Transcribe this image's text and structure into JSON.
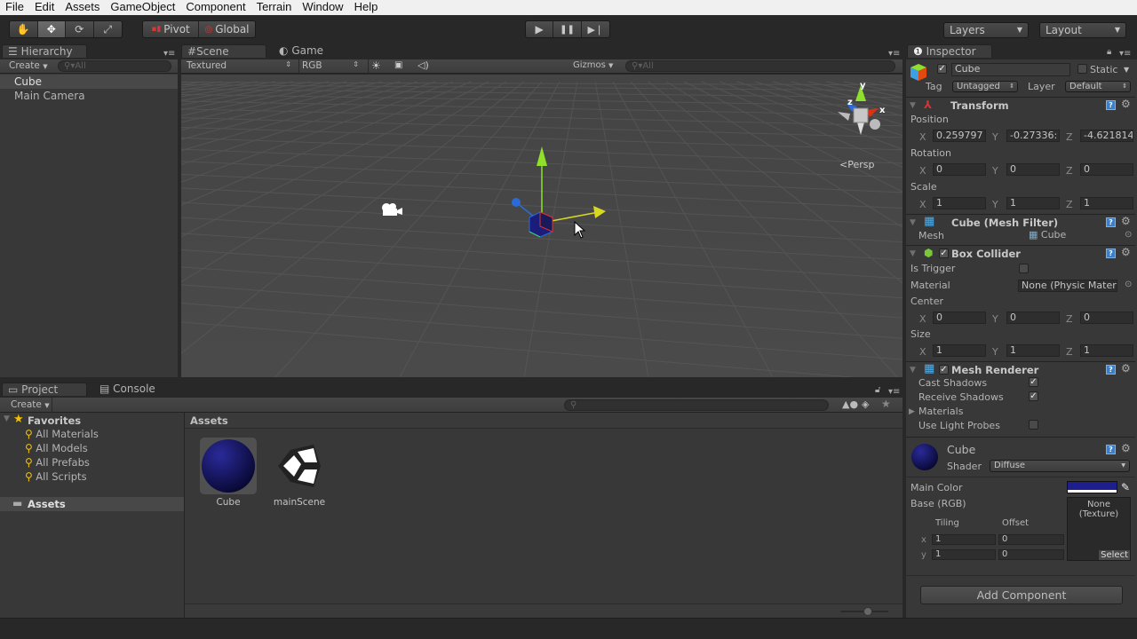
{
  "menu": [
    "File",
    "Edit",
    "Assets",
    "GameObject",
    "Component",
    "Terrain",
    "Window",
    "Help"
  ],
  "toolbar": {
    "tools": [
      {
        "name": "hand-tool",
        "icon": "hand-icon",
        "active": false
      },
      {
        "name": "move-tool",
        "icon": "move-icon",
        "active": true
      },
      {
        "name": "rotate-tool",
        "icon": "rotate-icon",
        "active": false
      },
      {
        "name": "scale-tool",
        "icon": "scale-icon",
        "active": false
      }
    ],
    "pivot_label": "Pivot",
    "global_label": "Global",
    "play_icon": "▶",
    "pause_icon": "❚❚",
    "step_icon": "▶❘",
    "layers_label": "Layers",
    "layout_label": "Layout"
  },
  "hierarchy": {
    "tab_label": "Hierarchy",
    "create_label": "Create",
    "search_placeholder": "All",
    "items": [
      {
        "label": "Cube",
        "selected": true
      },
      {
        "label": "Main Camera",
        "selected": false
      }
    ]
  },
  "scene": {
    "tabs": [
      {
        "label": "Scene",
        "active": true
      },
      {
        "label": "Game",
        "active": false
      }
    ],
    "render_mode": "Textured",
    "color_mode": "RGB",
    "gizmos_label": "Gizmos",
    "search_placeholder": "All",
    "view_label": "Persp",
    "axes": {
      "x": "x",
      "y": "y",
      "z": "z"
    }
  },
  "project": {
    "tabs": [
      {
        "label": "Project",
        "active": true
      },
      {
        "label": "Console",
        "active": false
      }
    ],
    "create_label": "Create",
    "favorites_label": "Favorites",
    "favorites": [
      "All Materials",
      "All Models",
      "All Prefabs",
      "All Scripts"
    ],
    "assets_folder": "Assets",
    "breadcrumb": "Assets",
    "assets": [
      {
        "name": "Cube",
        "type": "material",
        "selected": true
      },
      {
        "name": "mainScene",
        "type": "scene",
        "selected": false
      }
    ]
  },
  "inspector": {
    "tab_label": "Inspector",
    "object_name": "Cube",
    "object_active": true,
    "static_label": "Static",
    "tag_label": "Tag",
    "tag_value": "Untagged",
    "layer_label": "Layer",
    "layer_value": "Default",
    "transform": {
      "title": "Transform",
      "position_label": "Position",
      "position": {
        "x": "0.259797",
        "y": "-0.27336:",
        "z": "-4.621814"
      },
      "rotation_label": "Rotation",
      "rotation": {
        "x": "0",
        "y": "0",
        "z": "0"
      },
      "scale_label": "Scale",
      "scale": {
        "x": "1",
        "y": "1",
        "z": "1"
      }
    },
    "mesh_filter": {
      "title": "Cube (Mesh Filter)",
      "mesh_label": "Mesh",
      "mesh_value": "Cube"
    },
    "box_collider": {
      "title": "Box Collider",
      "enabled": true,
      "is_trigger_label": "Is Trigger",
      "is_trigger": false,
      "material_label": "Material",
      "material_value": "None (Physic Mater",
      "center_label": "Center",
      "center": {
        "x": "0",
        "y": "0",
        "z": "0"
      },
      "size_label": "Size",
      "size": {
        "x": "1",
        "y": "1",
        "z": "1"
      }
    },
    "mesh_renderer": {
      "title": "Mesh Renderer",
      "enabled": true,
      "cast_shadows_label": "Cast Shadows",
      "cast_shadows": true,
      "receive_shadows_label": "Receive Shadows",
      "receive_shadows": true,
      "materials_label": "Materials",
      "light_probes_label": "Use Light Probes",
      "light_probes": false
    },
    "material": {
      "name": "Cube",
      "shader_label": "Shader",
      "shader_value": "Diffuse",
      "main_color_label": "Main Color",
      "main_color": "#1e1e8c",
      "base_label": "Base (RGB)",
      "texture_none": "None",
      "texture_type": "(Texture)",
      "select_label": "Select",
      "tiling_label": "Tiling",
      "offset_label": "Offset",
      "tiling": {
        "x": "1",
        "y": "1"
      },
      "offset": {
        "x": "0",
        "y": "0"
      }
    },
    "add_component_label": "Add Component"
  }
}
